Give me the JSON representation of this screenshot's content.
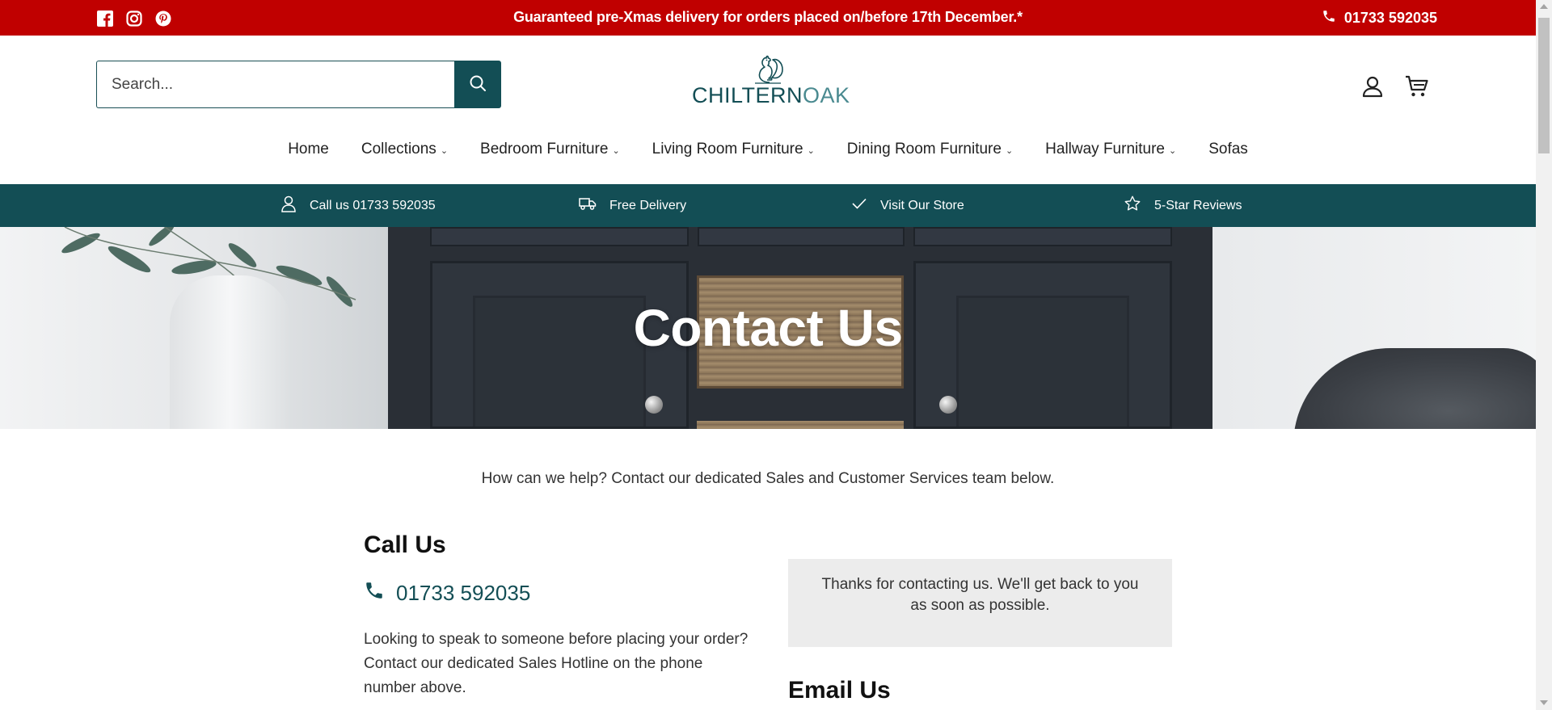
{
  "colors": {
    "announcement_bg": "#c00000",
    "brand_teal": "#134e55",
    "text": "#222222",
    "notice_bg": "#ececec"
  },
  "announcement": {
    "social_icons": [
      "facebook-icon",
      "instagram-icon",
      "pinterest-icon"
    ],
    "promo": "Guaranteed pre-Xmas delivery for orders placed on/before 17th December.*",
    "phone": "01733 592035"
  },
  "header": {
    "search_placeholder": "Search...",
    "logo": {
      "bold": "CHILTERN",
      "light": "OAK"
    }
  },
  "nav": {
    "items": [
      {
        "label": "Home",
        "has_dropdown": false
      },
      {
        "label": "Collections",
        "has_dropdown": true
      },
      {
        "label": "Bedroom Furniture",
        "has_dropdown": true
      },
      {
        "label": "Living Room Furniture",
        "has_dropdown": true
      },
      {
        "label": "Dining Room Furniture",
        "has_dropdown": true
      },
      {
        "label": "Hallway Furniture",
        "has_dropdown": true
      },
      {
        "label": "Sofas",
        "has_dropdown": false
      }
    ]
  },
  "usp": {
    "items": [
      {
        "icon": "person-icon",
        "label": "Call us 01733 592035"
      },
      {
        "icon": "truck-icon",
        "label": "Free Delivery"
      },
      {
        "icon": "check-icon",
        "label": "Visit Our Store"
      },
      {
        "icon": "star-icon",
        "label": "5-Star Reviews"
      }
    ]
  },
  "hero": {
    "title": "Contact Us"
  },
  "content": {
    "intro": "How can we help? Contact our dedicated Sales and Customer Services team below.",
    "call_us": {
      "heading": "Call Us",
      "phone": "01733 592035",
      "text": "Looking to speak to someone before placing your order? Contact our dedicated Sales Hotline on the phone number above."
    },
    "notice": "Thanks for contacting us. We'll get back to you as soon as possible.",
    "email_heading": "Email Us"
  }
}
